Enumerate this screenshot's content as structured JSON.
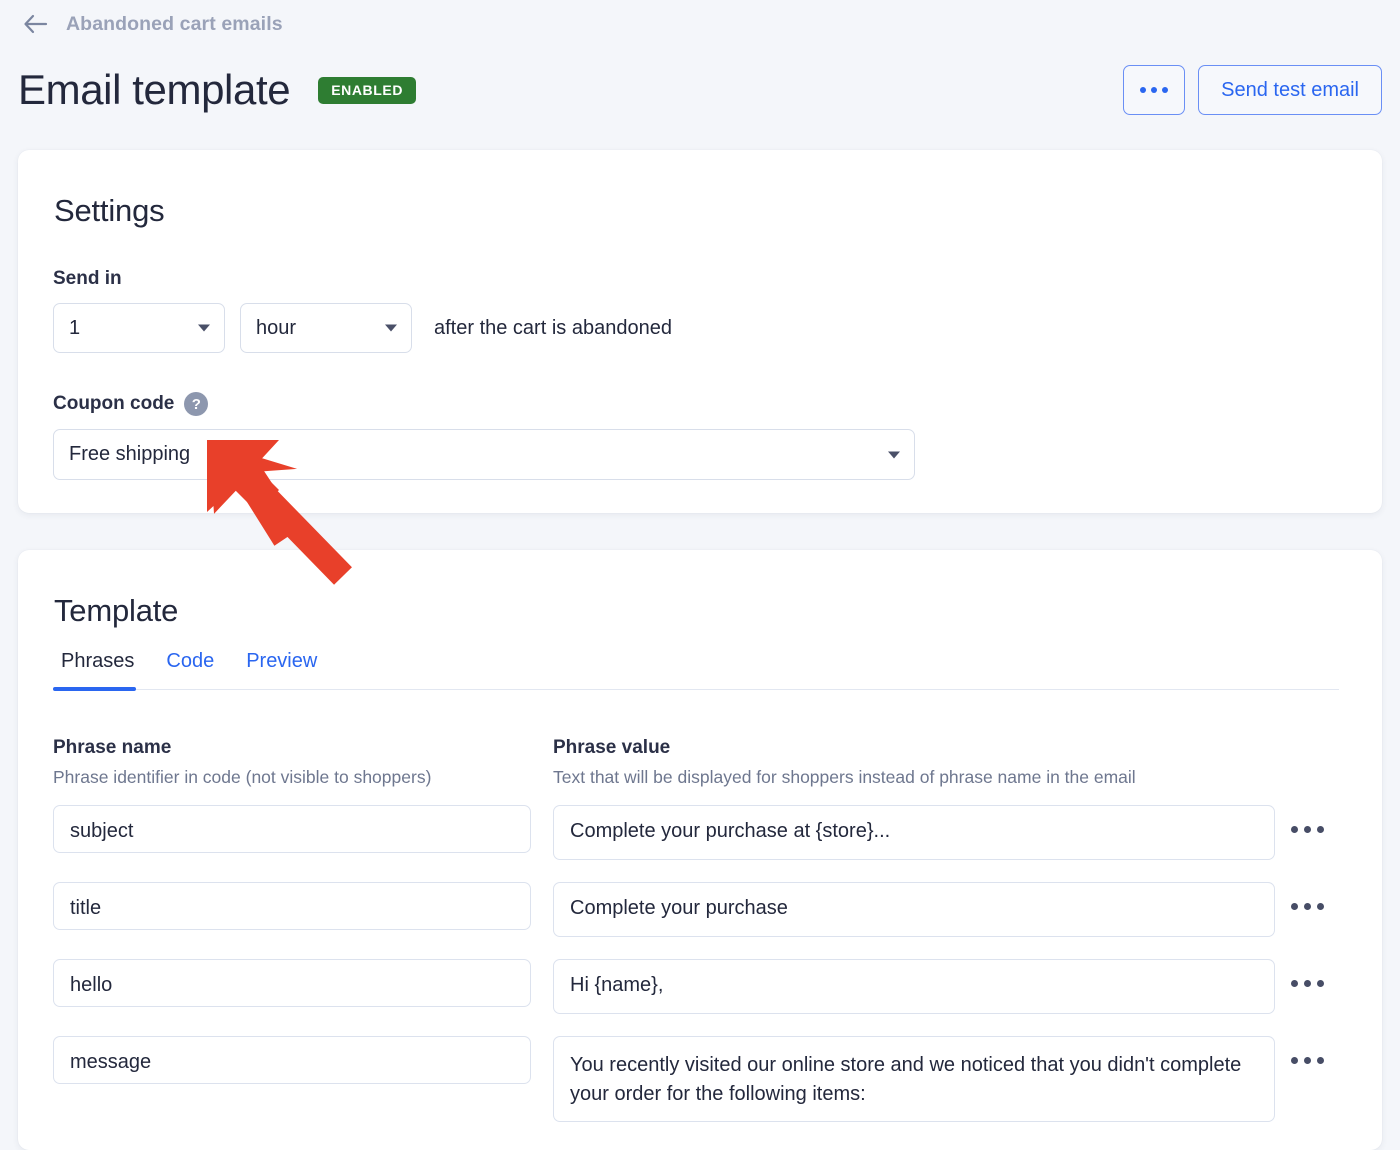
{
  "header": {
    "breadcrumb_label": "Abandoned cart emails",
    "back_icon": "arrow-left-icon",
    "page_title": "Email template",
    "status_badge": "ENABLED",
    "more_button_icon": "ellipsis-icon",
    "send_test_label": "Send test email"
  },
  "settings": {
    "card_title": "Settings",
    "send_in_label": "Send in",
    "send_in_amount": "1",
    "send_in_unit": "hour",
    "after_text": "after the cart is abandoned",
    "coupon_label": "Coupon code",
    "coupon_help_icon": "question-mark-icon",
    "coupon_value": "Free shipping"
  },
  "template": {
    "card_title": "Template",
    "tabs": [
      {
        "label": "Phrases",
        "active": true
      },
      {
        "label": "Code",
        "active": false
      },
      {
        "label": "Preview",
        "active": false
      }
    ],
    "columns": {
      "name_title": "Phrase name",
      "name_sub": "Phrase identifier in code (not visible to shoppers)",
      "value_title": "Phrase value",
      "value_sub": "Text that will be displayed for shoppers instead of phrase name in the email"
    },
    "rows": [
      {
        "name": "subject",
        "value": "Complete your purchase at {store}...",
        "menu_icon": "ellipsis-icon"
      },
      {
        "name": "title",
        "value": "Complete your purchase",
        "menu_icon": "ellipsis-icon"
      },
      {
        "name": "hello",
        "value": "Hi {name},",
        "menu_icon": "ellipsis-icon"
      },
      {
        "name": "message",
        "value": "You recently visited our online store and we noticed that you didn't complete your order for the following items:",
        "menu_icon": "ellipsis-icon"
      }
    ]
  },
  "annotation": {
    "arrow_icon": "red-pointer-arrow",
    "arrow_color": "#e8402a",
    "points_at": "coupon-code-select"
  },
  "colors": {
    "page_background": "#f4f6fa",
    "card_background": "#ffffff",
    "accent_blue": "#2a66f0",
    "badge_green": "#2e7d32",
    "text_primary": "#23283c",
    "text_muted": "#6e778f",
    "border": "#dce2ee"
  }
}
